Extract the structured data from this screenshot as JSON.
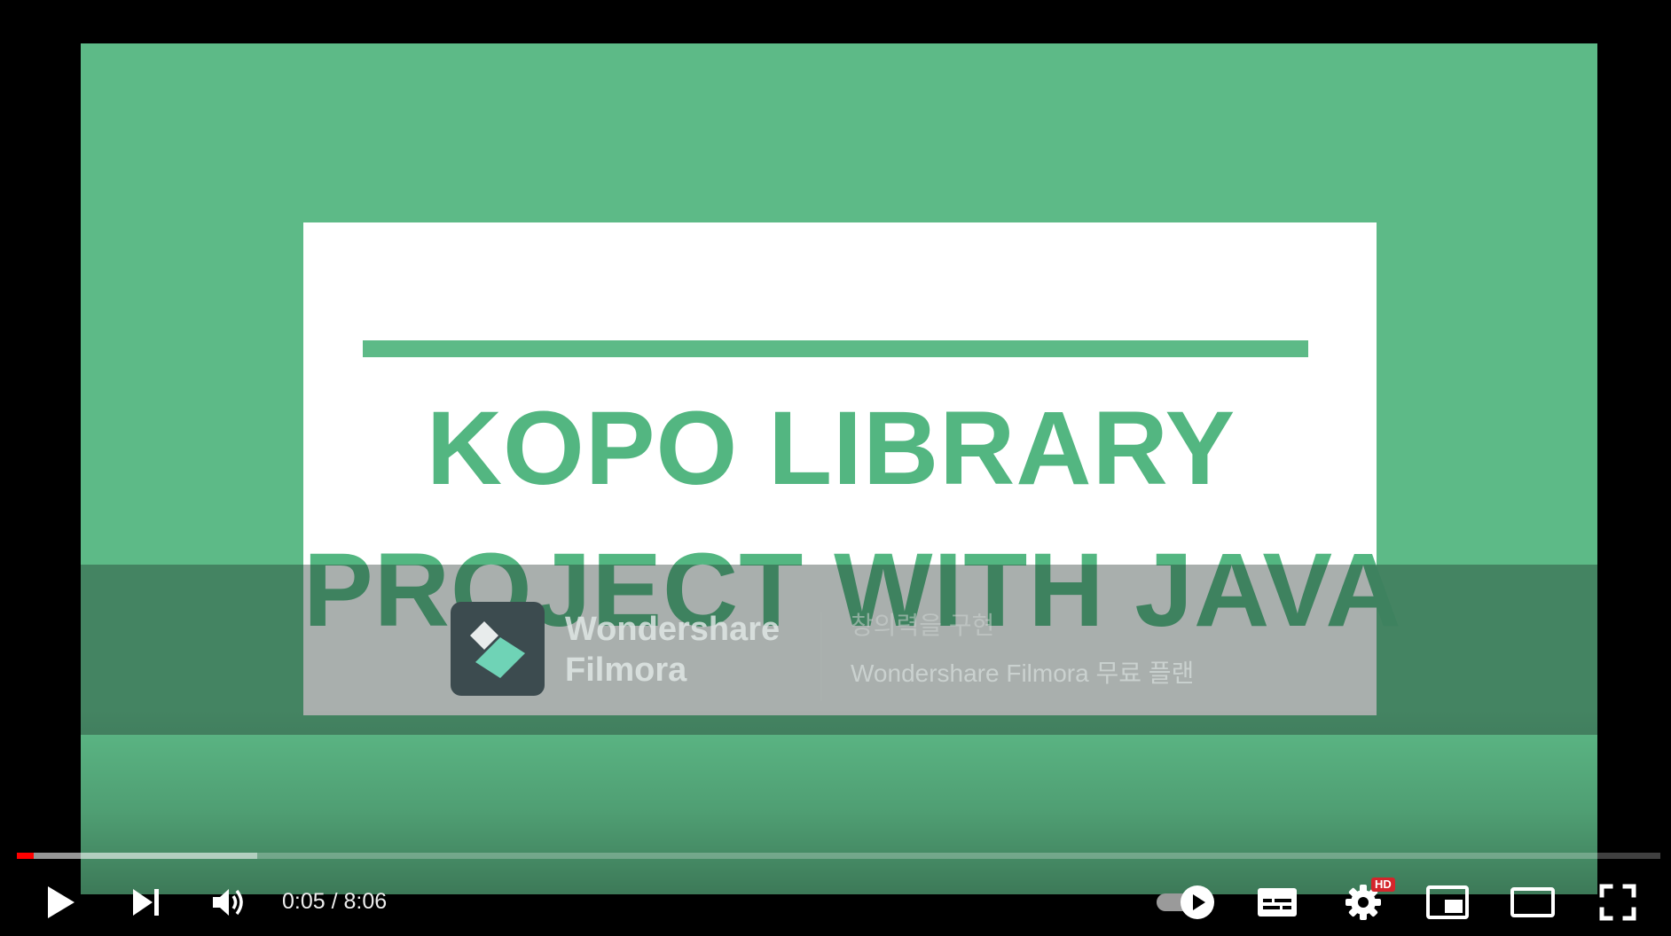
{
  "video": {
    "title_line_1": "KOPO LIBRARY",
    "title_line_2": "PROJECT WITH JAVA",
    "watermark": {
      "brand_line_1": "Wondershare",
      "brand_line_2": "Filmora",
      "slogan": "창의력을 구현",
      "plan": "Wondershare Filmora 무료 플랜"
    },
    "colors": {
      "frame_bg": "#5dba87",
      "title_text": "#53b681",
      "progress_played": "#ff0000"
    }
  },
  "controls": {
    "current_time": "0:05",
    "separator": " / ",
    "duration": "8:06",
    "progress_played_fraction": 0.0103,
    "progress_loaded_fraction": 0.146,
    "quality_badge": "HD",
    "icons": {
      "play": "play-icon",
      "next": "next-icon",
      "volume": "volume-icon",
      "autoplay": "autoplay-toggle-icon",
      "subtitles": "subtitles-icon",
      "settings": "gear-icon",
      "miniplayer": "miniplayer-icon",
      "theater": "theater-mode-icon",
      "fullscreen": "fullscreen-icon"
    }
  }
}
